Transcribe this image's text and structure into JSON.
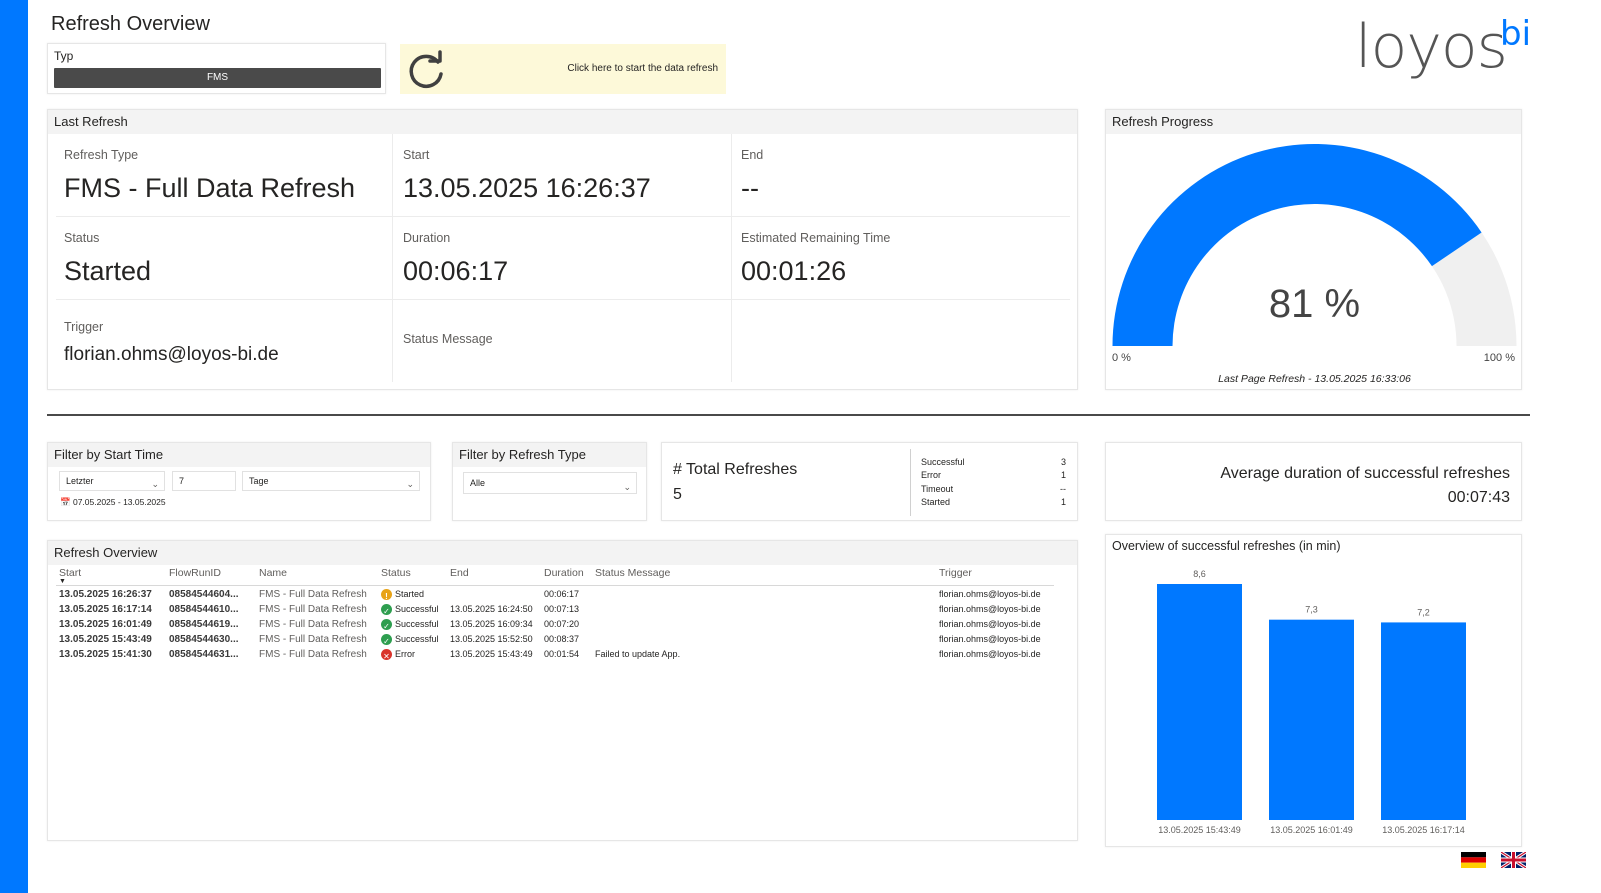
{
  "page": {
    "title": "Refresh Overview"
  },
  "logo": {
    "text": "loyos",
    "suffix": "bi"
  },
  "typ_filter": {
    "label": "Typ",
    "value": "FMS"
  },
  "refresh_button": {
    "label": "Click here to start the data refresh",
    "icon": "refresh-icon"
  },
  "last_refresh": {
    "title": "Last Refresh",
    "refresh_type_label": "Refresh Type",
    "refresh_type_value": "FMS - Full Data Refresh",
    "start_label": "Start",
    "start_value": "13.05.2025 16:26:37",
    "end_label": "End",
    "end_value": "--",
    "status_label": "Status",
    "status_value": "Started",
    "duration_label": "Duration",
    "duration_value": "00:06:17",
    "remaining_label": "Estimated Remaining Time",
    "remaining_value": "00:01:26",
    "trigger_label": "Trigger",
    "trigger_value": "florian.ohms@loyos-bi.de",
    "status_message_label": "Status Message"
  },
  "progress": {
    "title": "Refresh Progress",
    "value": 81,
    "value_label": "81 %",
    "min_label": "0 %",
    "max_label": "100 %",
    "footer": "Last Page Refresh - 13.05.2025 16:33:06",
    "fill_color": "#0078FF",
    "track_color": "#F0F0F0"
  },
  "filter_start": {
    "title": "Filter by Start Time",
    "mode": "Letzter",
    "amount": "7",
    "unit": "Tage",
    "range": "07.05.2025 - 13.05.2025"
  },
  "filter_type": {
    "title": "Filter by Refresh Type",
    "value": "Alle"
  },
  "totals": {
    "title": "# Total Refreshes",
    "value": "5",
    "breakdown": [
      {
        "label": "Successful",
        "value": "3"
      },
      {
        "label": "Error",
        "value": "1"
      },
      {
        "label": "Timeout",
        "value": "--"
      },
      {
        "label": "Started",
        "value": "1"
      }
    ]
  },
  "average": {
    "title": "Average duration of successful refreshes",
    "value": "00:07:43"
  },
  "table": {
    "title": "Refresh Overview",
    "columns": [
      "Start",
      "FlowRunID",
      "Name",
      "Status",
      "End",
      "Duration",
      "Status Message",
      "Trigger"
    ],
    "rows": [
      {
        "start": "13.05.2025 16:26:37",
        "flow": "08584544604...",
        "name": "FMS - Full Data Refresh",
        "status": "Started",
        "end": "",
        "duration": "00:06:17",
        "message": "",
        "trigger": "florian.ohms@loyos-bi.de"
      },
      {
        "start": "13.05.2025 16:17:14",
        "flow": "08584544610...",
        "name": "FMS - Full Data Refresh",
        "status": "Successful",
        "end": "13.05.2025 16:24:50",
        "duration": "00:07:13",
        "message": "",
        "trigger": "florian.ohms@loyos-bi.de"
      },
      {
        "start": "13.05.2025 16:01:49",
        "flow": "08584544619...",
        "name": "FMS - Full Data Refresh",
        "status": "Successful",
        "end": "13.05.2025 16:09:34",
        "duration": "00:07:20",
        "message": "",
        "trigger": "florian.ohms@loyos-bi.de"
      },
      {
        "start": "13.05.2025 15:43:49",
        "flow": "08584544630...",
        "name": "FMS - Full Data Refresh",
        "status": "Successful",
        "end": "13.05.2025 15:52:50",
        "duration": "00:08:37",
        "message": "",
        "trigger": "florian.ohms@loyos-bi.de"
      },
      {
        "start": "13.05.2025 15:41:30",
        "flow": "08584544631...",
        "name": "FMS - Full Data Refresh",
        "status": "Error",
        "end": "13.05.2025 15:43:49",
        "duration": "00:01:54",
        "message": "Failed to update App.",
        "trigger": "florian.ohms@loyos-bi.de"
      }
    ]
  },
  "chart_title": "Overview of successful refreshes (in min)",
  "chart_data": {
    "type": "bar",
    "title": "Overview of successful refreshes (in min)",
    "categories": [
      "13.05.2025 15:43:49",
      "13.05.2025 16:01:49",
      "13.05.2025 16:17:14"
    ],
    "values": [
      8.6,
      7.3,
      7.2
    ],
    "data_labels": [
      "8,6",
      "7,3",
      "7,2"
    ],
    "xlabel": "",
    "ylabel": "",
    "ylim": [
      0,
      8.6
    ],
    "grid": false,
    "color": "#0078FF"
  },
  "flags": [
    "german-flag-icon",
    "uk-flag-icon"
  ],
  "colors": {
    "accent": "#0078FF",
    "warning": "#E8A317",
    "success": "#2E9E4F",
    "error": "#D9342B"
  }
}
